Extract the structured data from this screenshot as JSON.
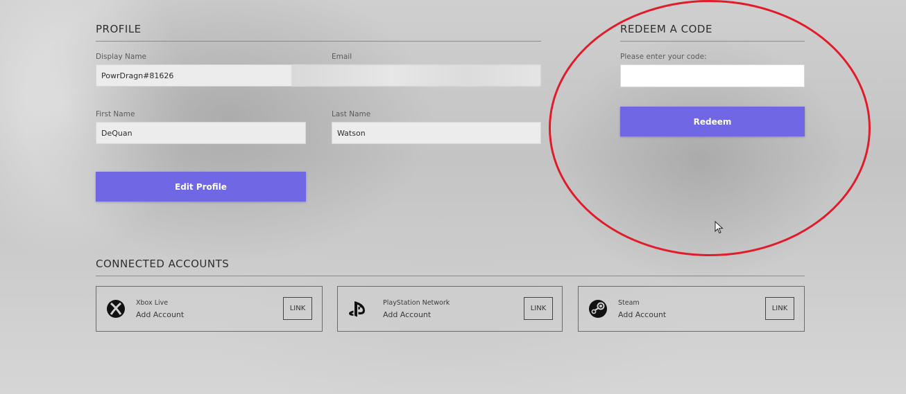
{
  "profile": {
    "title": "PROFILE",
    "display_name_label": "Display Name",
    "display_name_value": "PowrDragn#81626",
    "email_label": "Email",
    "email_value": "",
    "first_name_label": "First Name",
    "first_name_value": "DeQuan",
    "last_name_label": "Last Name",
    "last_name_value": "Watson",
    "edit_button_label": "Edit Profile"
  },
  "redeem": {
    "title": "REDEEM A CODE",
    "code_label": "Please enter your code:",
    "code_value": "",
    "redeem_button_label": "Redeem"
  },
  "connected_accounts": {
    "title": "CONNECTED ACCOUNTS",
    "accounts": [
      {
        "name": "Xbox Live",
        "action": "Add Account",
        "link_label": "LINK",
        "icon": "xbox-icon"
      },
      {
        "name": "PlayStation Network",
        "action": "Add Account",
        "link_label": "LINK",
        "icon": "playstation-icon"
      },
      {
        "name": "Steam",
        "action": "Add Account",
        "link_label": "LINK",
        "icon": "steam-icon"
      }
    ]
  },
  "colors": {
    "accent": "#6f67e3",
    "highlight": "#e21b2a"
  }
}
